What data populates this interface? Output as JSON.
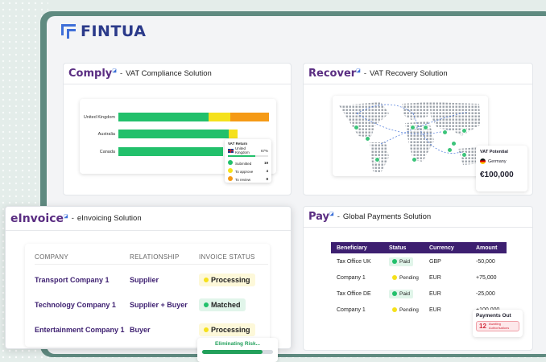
{
  "brand": {
    "name": "FINTUA",
    "color": "#2b3a8a",
    "accent": "#3f6fd8"
  },
  "comply": {
    "brand": "Comply",
    "title": "VAT Compliance Solution",
    "rows": [
      "United Kingdom",
      "Australia",
      "Canada"
    ],
    "popup": {
      "title": "VAT Return",
      "country": "United Kingdom",
      "percent": "67%",
      "items": [
        {
          "label": "Submitted",
          "value": "19",
          "color": "#22c06b"
        },
        {
          "label": "To approve",
          "value": "4",
          "color": "#f5e11c"
        },
        {
          "label": "To review",
          "value": "8",
          "color": "#f59a16"
        }
      ]
    }
  },
  "chart_data": {
    "type": "bar",
    "categories": [
      "United Kingdom",
      "Australia",
      "Canada"
    ],
    "series": [
      {
        "values": [
          19,
          28,
          30
        ],
        "color": "#22c06b"
      },
      {
        "values": [
          4,
          2,
          0
        ],
        "color": "#f5e11c"
      },
      {
        "values": [
          8,
          0,
          0
        ],
        "color": "#f59a16"
      }
    ]
  },
  "recover": {
    "brand": "Recover",
    "title": "VAT Recovery Solution",
    "potential_title": "VAT Potential",
    "country": "Germany",
    "amount": "€100,000"
  },
  "einvoice": {
    "brand": "eInvoice",
    "title": "eInvoicing Solution",
    "headers": [
      "COMPANY",
      "RELATIONSHIP",
      "INVOICE STATUS"
    ],
    "rows": [
      {
        "company": "Transport Company 1",
        "relationship": "Supplier",
        "status": "Processing",
        "color": "#f5e11c",
        "bg": "#fdf8d9"
      },
      {
        "company": "Technology Company 1",
        "relationship": "Supplier + Buyer",
        "status": "Matched",
        "color": "#22c06b",
        "bg": "#e1f5ea"
      },
      {
        "company": "Entertainment Company 1",
        "relationship": "Buyer",
        "status": "Processing",
        "color": "#f5e11c",
        "bg": "#fdf8d9"
      }
    ],
    "toast": "Eliminating Risk...",
    "toast_progress": 0.85
  },
  "pay": {
    "brand": "Pay",
    "title": "Global Payments Solution",
    "headers": [
      "Beneficiary",
      "Status",
      "Currency",
      "Amount"
    ],
    "rows": [
      {
        "beneficiary": "Tax Office UK",
        "status": "Paid",
        "currency": "GBP",
        "amount": "-50,000",
        "color": "#22c06b",
        "bg": "#e1f5ea"
      },
      {
        "beneficiary": "Company 1",
        "status": "Pending",
        "currency": "EUR",
        "amount": "+75,000",
        "color": "#f5e11c",
        "bg": "#ffffff"
      },
      {
        "beneficiary": "Tax Office DE",
        "status": "Paid",
        "currency": "EUR",
        "amount": "-25,000",
        "color": "#22c06b",
        "bg": "#e1f5ea"
      },
      {
        "beneficiary": "Company 1",
        "status": "Pending",
        "currency": "EUR",
        "amount": "+100,000",
        "color": "#f5e11c",
        "bg": "#ffffff"
      }
    ],
    "payments_out": {
      "title": "Payments Out",
      "count": "12",
      "label1": "Awaiting",
      "label2": "Authorisations"
    }
  }
}
